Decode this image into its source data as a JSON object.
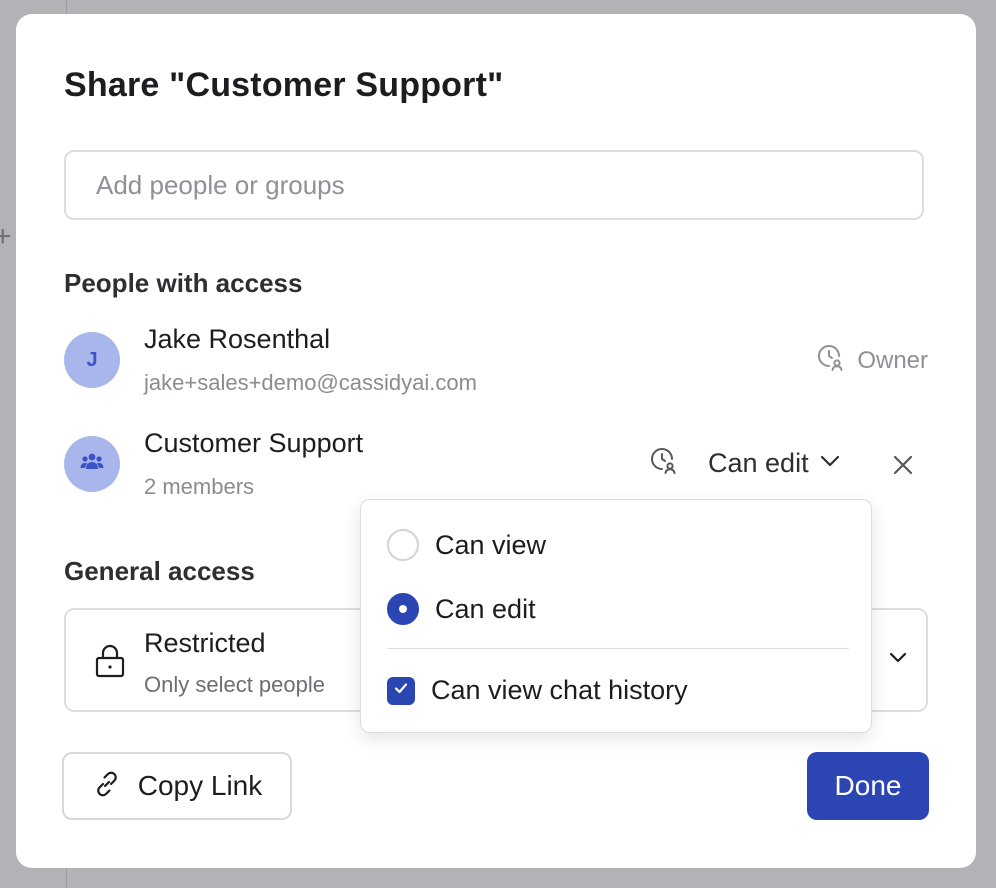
{
  "dialog": {
    "title": "Share \"Customer Support\"",
    "search_placeholder": "Add people or groups"
  },
  "people": {
    "heading": "People with access",
    "list": [
      {
        "avatar_initial": "J",
        "name": "Jake Rosenthal",
        "subtitle": "jake+sales+demo@cassidyai.com",
        "role": "Owner",
        "icon": "history-user-icon"
      },
      {
        "avatar_icon": "group-icon",
        "name": "Customer Support",
        "subtitle": "2 members",
        "role": "Can edit",
        "icon": "history-user-icon"
      }
    ]
  },
  "general_access": {
    "heading": "General access",
    "value": "Restricted",
    "description": "Only select people"
  },
  "permission_menu": {
    "options": [
      {
        "label": "Can view",
        "selected": false
      },
      {
        "label": "Can edit",
        "selected": true
      }
    ],
    "checkbox": {
      "label": "Can view chat history",
      "checked": true
    }
  },
  "footer": {
    "copy_link": "Copy Link",
    "done": "Done"
  },
  "colors": {
    "accent": "#2b45b3",
    "avatar_bg": "#a9b6ec",
    "backdrop": "#b3b3b7"
  }
}
